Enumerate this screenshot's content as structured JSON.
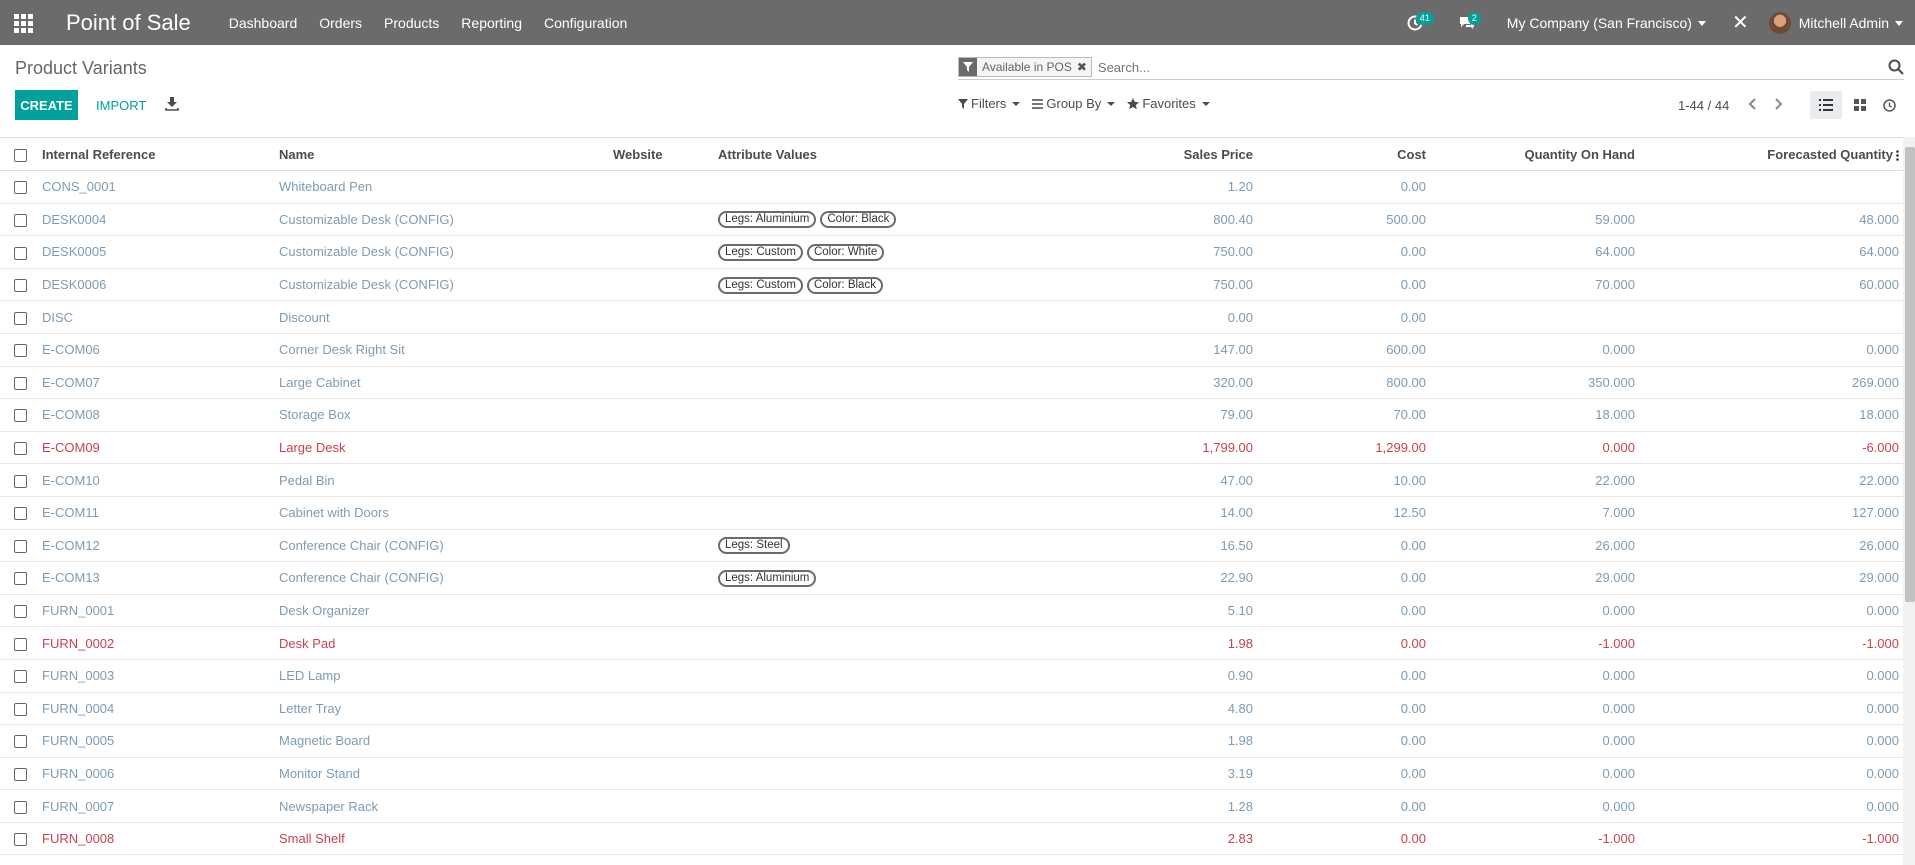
{
  "nav": {
    "brand": "Point of Sale",
    "menu": [
      "Dashboard",
      "Orders",
      "Products",
      "Reporting",
      "Configuration"
    ],
    "activity_count": "41",
    "message_count": "2",
    "company": "My Company (San Francisco)",
    "close": "✕",
    "user": "Mitchell Admin"
  },
  "control": {
    "title": "Product Variants",
    "facet": "Available in POS",
    "search_placeholder": "Search...",
    "create": "CREATE",
    "import": "IMPORT",
    "filters": "Filters",
    "group_by": "Group By",
    "favorites": "Favorites",
    "pager": "1-44 / 44"
  },
  "table": {
    "headers": {
      "ref": "Internal Reference",
      "name": "Name",
      "website": "Website",
      "attrs": "Attribute Values",
      "price": "Sales Price",
      "cost": "Cost",
      "qty": "Quantity On Hand",
      "forecast": "Forecasted Quantity"
    },
    "rows": [
      {
        "ref": "CONS_0001",
        "name": "Whiteboard Pen",
        "tags": [],
        "price": "1.20",
        "cost": "0.00",
        "qty": "",
        "forecast": "",
        "neg": false
      },
      {
        "ref": "DESK0004",
        "name": "Customizable Desk (CONFIG)",
        "tags": [
          "Legs: Aluminium",
          "Color: Black"
        ],
        "price": "800.40",
        "cost": "500.00",
        "qty": "59.000",
        "forecast": "48.000",
        "neg": false
      },
      {
        "ref": "DESK0005",
        "name": "Customizable Desk (CONFIG)",
        "tags": [
          "Legs: Custom",
          "Color: White"
        ],
        "price": "750.00",
        "cost": "0.00",
        "qty": "64.000",
        "forecast": "64.000",
        "neg": false
      },
      {
        "ref": "DESK0006",
        "name": "Customizable Desk (CONFIG)",
        "tags": [
          "Legs: Custom",
          "Color: Black"
        ],
        "price": "750.00",
        "cost": "0.00",
        "qty": "70.000",
        "forecast": "60.000",
        "neg": false
      },
      {
        "ref": "DISC",
        "name": "Discount",
        "tags": [],
        "price": "0.00",
        "cost": "0.00",
        "qty": "",
        "forecast": "",
        "neg": false
      },
      {
        "ref": "E-COM06",
        "name": "Corner Desk Right Sit",
        "tags": [],
        "price": "147.00",
        "cost": "600.00",
        "qty": "0.000",
        "forecast": "0.000",
        "neg": false
      },
      {
        "ref": "E-COM07",
        "name": "Large Cabinet",
        "tags": [],
        "price": "320.00",
        "cost": "800.00",
        "qty": "350.000",
        "forecast": "269.000",
        "neg": false
      },
      {
        "ref": "E-COM08",
        "name": "Storage Box",
        "tags": [],
        "price": "79.00",
        "cost": "70.00",
        "qty": "18.000",
        "forecast": "18.000",
        "neg": false
      },
      {
        "ref": "E-COM09",
        "name": "Large Desk",
        "tags": [],
        "price": "1,799.00",
        "cost": "1,299.00",
        "qty": "0.000",
        "forecast": "-6.000",
        "neg": true
      },
      {
        "ref": "E-COM10",
        "name": "Pedal Bin",
        "tags": [],
        "price": "47.00",
        "cost": "10.00",
        "qty": "22.000",
        "forecast": "22.000",
        "neg": false
      },
      {
        "ref": "E-COM11",
        "name": "Cabinet with Doors",
        "tags": [],
        "price": "14.00",
        "cost": "12.50",
        "qty": "7.000",
        "forecast": "127.000",
        "neg": false
      },
      {
        "ref": "E-COM12",
        "name": "Conference Chair (CONFIG)",
        "tags": [
          "Legs: Steel"
        ],
        "price": "16.50",
        "cost": "0.00",
        "qty": "26.000",
        "forecast": "26.000",
        "neg": false
      },
      {
        "ref": "E-COM13",
        "name": "Conference Chair (CONFIG)",
        "tags": [
          "Legs: Aluminium"
        ],
        "price": "22.90",
        "cost": "0.00",
        "qty": "29.000",
        "forecast": "29.000",
        "neg": false
      },
      {
        "ref": "FURN_0001",
        "name": "Desk Organizer",
        "tags": [],
        "price": "5.10",
        "cost": "0.00",
        "qty": "0.000",
        "forecast": "0.000",
        "neg": false
      },
      {
        "ref": "FURN_0002",
        "name": "Desk Pad",
        "tags": [],
        "price": "1.98",
        "cost": "0.00",
        "qty": "-1.000",
        "forecast": "-1.000",
        "neg": true
      },
      {
        "ref": "FURN_0003",
        "name": "LED Lamp",
        "tags": [],
        "price": "0.90",
        "cost": "0.00",
        "qty": "0.000",
        "forecast": "0.000",
        "neg": false
      },
      {
        "ref": "FURN_0004",
        "name": "Letter Tray",
        "tags": [],
        "price": "4.80",
        "cost": "0.00",
        "qty": "0.000",
        "forecast": "0.000",
        "neg": false
      },
      {
        "ref": "FURN_0005",
        "name": "Magnetic Board",
        "tags": [],
        "price": "1.98",
        "cost": "0.00",
        "qty": "0.000",
        "forecast": "0.000",
        "neg": false
      },
      {
        "ref": "FURN_0006",
        "name": "Monitor Stand",
        "tags": [],
        "price": "3.19",
        "cost": "0.00",
        "qty": "0.000",
        "forecast": "0.000",
        "neg": false
      },
      {
        "ref": "FURN_0007",
        "name": "Newspaper Rack",
        "tags": [],
        "price": "1.28",
        "cost": "0.00",
        "qty": "0.000",
        "forecast": "0.000",
        "neg": false
      },
      {
        "ref": "FURN_0008",
        "name": "Small Shelf",
        "tags": [],
        "price": "2.83",
        "cost": "0.00",
        "qty": "-1.000",
        "forecast": "-1.000",
        "neg": true
      }
    ]
  },
  "colors": {
    "navbar": "#6b6b6b",
    "primary": "#00a09d",
    "link": "#7c9cb5",
    "negative": "#c9424e"
  }
}
